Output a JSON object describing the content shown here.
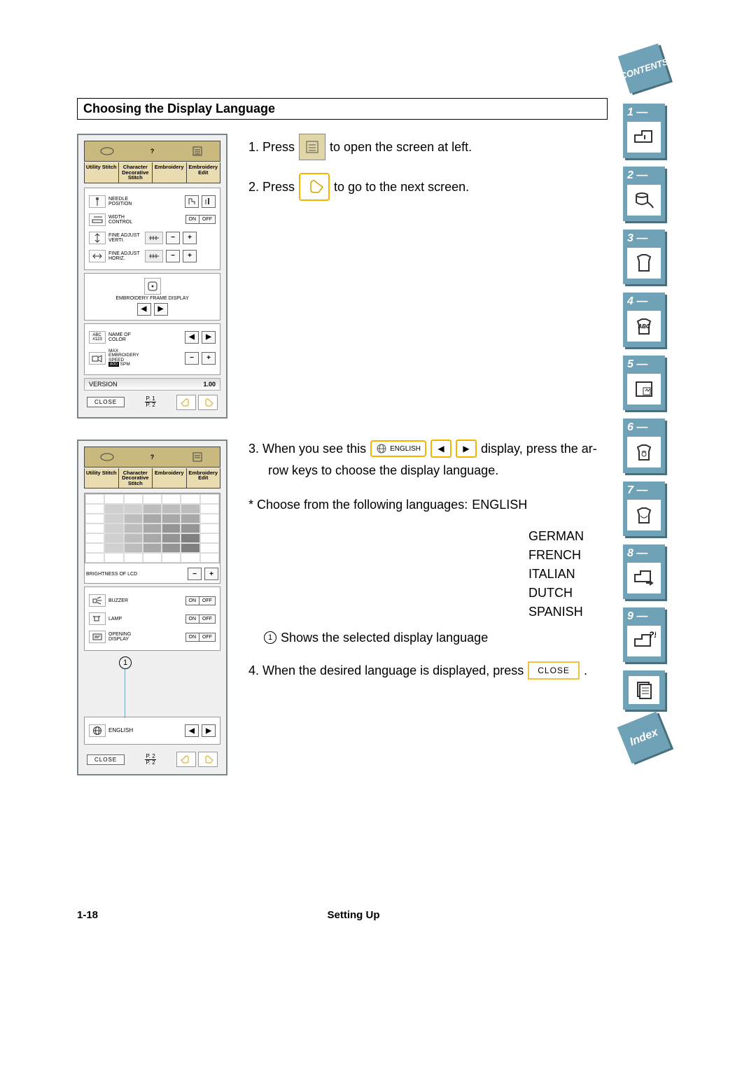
{
  "section_title": "Choosing the Display Language",
  "instructions": {
    "step1_pre": "1.  Press",
    "step1_post": "to open the screen at left.",
    "step2_pre": "2.  Press",
    "step2_post": "to go to the next screen.",
    "step3_pre": "3.  When you see this",
    "step3_post_a": "display, press the ar-",
    "step3_post_b": "row keys to choose the display language.",
    "choose_prefix": "*    Choose from the following languages:",
    "languages": [
      "ENGLISH",
      "GERMAN",
      "FRENCH",
      "ITALIAN",
      "DUTCH",
      "SPANISH"
    ],
    "note1_num": "1",
    "note1": "Shows the selected display language",
    "step4_pre": "4.  When the desired language is displayed, press",
    "step4_post": "."
  },
  "screen1": {
    "tabs": [
      "Utility Stitch",
      "Character Decorative Stitch",
      "Embroidery",
      "Embroidery Edit"
    ],
    "needle_position": "NEEDLE POSITION",
    "width_control": "WIDTH CONTROL",
    "on": "ON",
    "off": "OFF",
    "fine_vert": "FINE ADJUST VERTI.",
    "fine_horz": "FINE ADJUST HORIZ.",
    "emb_frame": "EMBROIDERY FRAME DISPLAY",
    "name_color": "NAME OF COLOR",
    "max_speed": "MAX EMBROIDERY SPEED",
    "max_speed_val": "800",
    "spm": "SPM",
    "version_label": "VERSION",
    "version_value": "1.00",
    "close": "CLOSE",
    "page_top": "P. 1",
    "page_bot": "P. 2"
  },
  "screen2": {
    "brightness": "BRIGHTNESS OF LCD",
    "buzzer": "BUZZER",
    "lamp": "LAMP",
    "opening": "OPENING DISPLAY",
    "on": "ON",
    "off": "OFF",
    "english": "ENGLISH",
    "close": "CLOSE",
    "page_top": "P. 2",
    "page_bot": "P. 2",
    "callout_num": "1"
  },
  "inline": {
    "english_pill": "ENGLISH",
    "close_btn": "CLOSE"
  },
  "sidebar": {
    "contents": "CONTENTS",
    "tabs": [
      "1 —",
      "2 —",
      "3 —",
      "4 —",
      "5 —",
      "6 —",
      "7 —",
      "8 —",
      "9 —"
    ],
    "index": "Index"
  },
  "footer": {
    "left": "1-18",
    "center": "Setting Up"
  }
}
